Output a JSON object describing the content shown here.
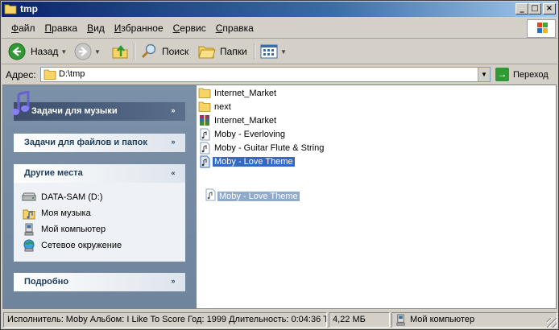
{
  "window": {
    "title": "tmp"
  },
  "menu": [
    {
      "label": "Файл",
      "accel": "Ф",
      "rest": "айл"
    },
    {
      "label": "Правка",
      "accel": "П",
      "rest": "равка"
    },
    {
      "label": "Вид",
      "accel": "В",
      "rest": "ид"
    },
    {
      "label": "Избранное",
      "accel": "И",
      "rest": "збранное"
    },
    {
      "label": "Сервис",
      "accel": "С",
      "rest": "ервис"
    },
    {
      "label": "Справка",
      "accel": "С",
      "rest": "правка"
    }
  ],
  "toolbar": {
    "back_label": "Назад",
    "search_label": "Поиск",
    "folders_label": "Папки"
  },
  "address": {
    "label": "Адрес:",
    "value": "D:\\tmp",
    "go_label": "Переход"
  },
  "taskpane": {
    "music_tasks": "Задачи для музыки",
    "file_tasks": "Задачи для файлов и папок",
    "other_places": {
      "title": "Другие места",
      "items": [
        {
          "label": "DATA-SAM (D:)",
          "icon": "drive-icon"
        },
        {
          "label": "Моя музыка",
          "icon": "my-music-icon"
        },
        {
          "label": "Мой компьютер",
          "icon": "my-computer-icon"
        },
        {
          "label": "Сетевое окружение",
          "icon": "network-icon"
        }
      ]
    },
    "details": "Подробно"
  },
  "files": [
    {
      "name": "Internet_Market",
      "icon": "folder-icon",
      "selected": false
    },
    {
      "name": "next",
      "icon": "folder-icon",
      "selected": false
    },
    {
      "name": "Internet_Market",
      "icon": "archive-icon",
      "selected": false
    },
    {
      "name": "Moby - Everloving",
      "icon": "audio-file-icon",
      "selected": false
    },
    {
      "name": "Moby - Guitar Flute & String",
      "icon": "audio-file-icon",
      "selected": false
    },
    {
      "name": "Moby - Love Theme",
      "icon": "audio-file-icon",
      "selected": true
    }
  ],
  "drag_ghost": {
    "name": "Moby - Love Theme"
  },
  "status": {
    "info": "Исполнитель: Moby Альбом: I Like To Score Год: 1999 Длительность: 0:04:36 Т",
    "size": "4,22 МБ",
    "location": "Мой компьютер"
  },
  "colors": {
    "title_gradient_start": "#0a246a",
    "taskpane_bg": "#7b91a8",
    "selection": "#316ac5"
  }
}
